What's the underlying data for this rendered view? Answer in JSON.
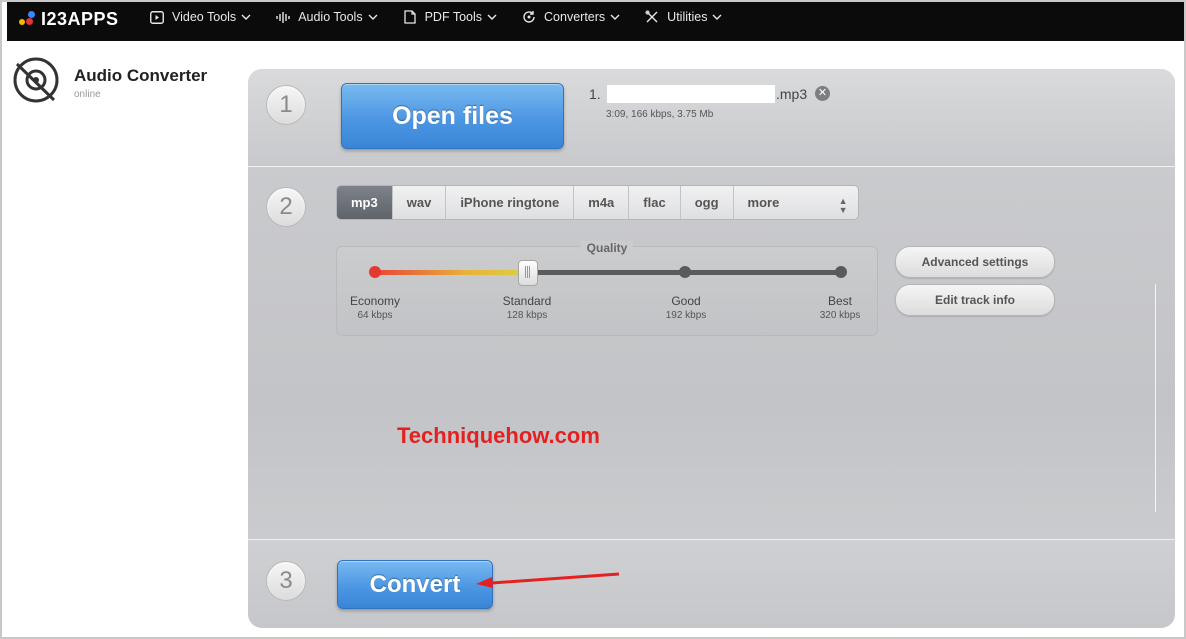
{
  "brand": {
    "logo_text": "I23APPS"
  },
  "nav": [
    {
      "label": "Video Tools",
      "icon": "play-icon"
    },
    {
      "label": "Audio Tools",
      "icon": "waveform-icon"
    },
    {
      "label": "PDF Tools",
      "icon": "document-icon"
    },
    {
      "label": "Converters",
      "icon": "convert-icon"
    },
    {
      "label": "Utilities",
      "icon": "tools-icon"
    }
  ],
  "app": {
    "title": "Audio Converter",
    "subtitle": "online"
  },
  "steps": {
    "one": "1",
    "two": "2",
    "three": "3"
  },
  "open_files_label": "Open files",
  "file": {
    "index": "1.",
    "name_suffix": ".mp3",
    "info": "3:09, 166 kbps, 3.75 Mb",
    "remove_icon": "close-circle-icon"
  },
  "formats": {
    "tabs": [
      "mp3",
      "wav",
      "iPhone ringtone",
      "m4a",
      "flac",
      "ogg"
    ],
    "more_label": "more",
    "selected": "mp3"
  },
  "quality": {
    "title": "Quality",
    "selected_level": 0.327,
    "levels": [
      {
        "name": "Economy",
        "rate": "64 kbps"
      },
      {
        "name": "Standard",
        "rate": "128 kbps"
      },
      {
        "name": "Good",
        "rate": "192 kbps"
      },
      {
        "name": "Best",
        "rate": "320 kbps"
      }
    ]
  },
  "buttons": {
    "advanced_settings": "Advanced settings",
    "edit_track_info": "Edit track info",
    "convert": "Convert"
  },
  "watermark": "Techniquehow.com",
  "colors": {
    "accent_blue": "#4c97e3",
    "watermark_red": "#e42121",
    "topbar": "#0b0b0b"
  }
}
